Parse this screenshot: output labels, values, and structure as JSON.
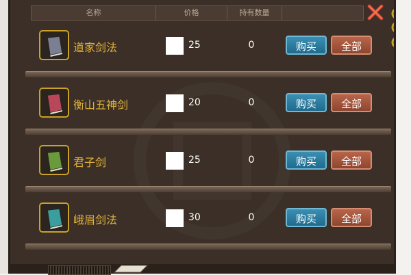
{
  "header": {
    "col_name": "名称",
    "col_price": "价格",
    "col_held": "持有数量"
  },
  "items": [
    {
      "name": "道家剑法",
      "price": "25",
      "held": "0",
      "buy": "购买",
      "all": "全部",
      "book_color": "#7b7f93"
    },
    {
      "name": "衡山五神剑",
      "price": "20",
      "held": "0",
      "buy": "购买",
      "all": "全部",
      "book_color": "#b8475a"
    },
    {
      "name": "君子剑",
      "price": "25",
      "held": "0",
      "buy": "购买",
      "all": "全部",
      "book_color": "#6a9a3c"
    },
    {
      "name": "峨眉剑法",
      "price": "30",
      "held": "0",
      "buy": "购买",
      "all": "全部",
      "book_color": "#3a9e9e"
    }
  ],
  "colors": {
    "panel_bg": "#3b2f27",
    "name_gold": "#e0b23c",
    "buy_blue": "#1f6b8d",
    "all_red": "#8e4630",
    "icon_border": "#c9a227"
  }
}
